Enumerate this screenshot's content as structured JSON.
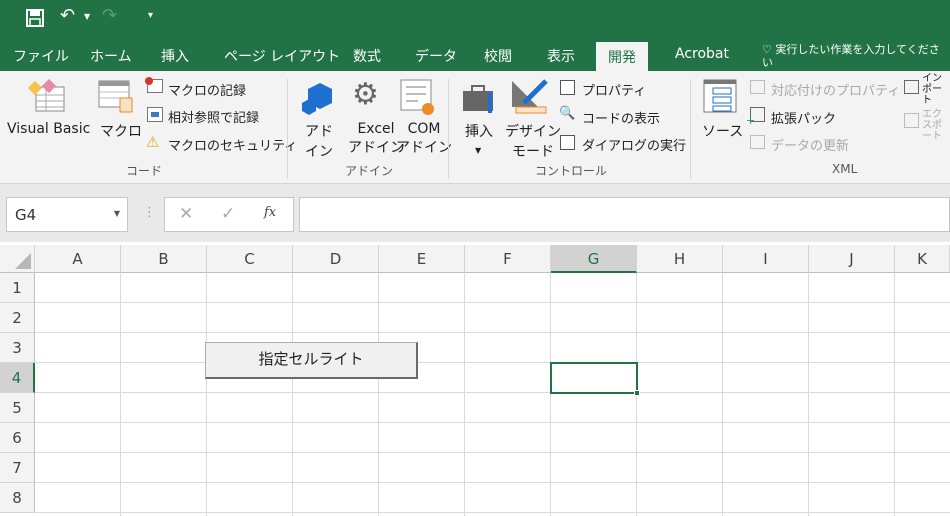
{
  "qat": {
    "save_icon": "save-icon",
    "undo_icon": "undo-icon",
    "redo_icon": "redo-icon",
    "customize_icon": "customize-qat-icon"
  },
  "tabs": [
    "ファイル",
    "ホーム",
    "挿入",
    "ページ レイアウト",
    "数式",
    "データ",
    "校閲",
    "表示",
    "開発",
    "Acrobat"
  ],
  "active_tab": "開発",
  "tell_me": "実行したい作業を入力してください",
  "ribbon": {
    "code": {
      "label": "コード",
      "visual_basic": "Visual Basic",
      "macro": "マクロ",
      "record": "マクロの記録",
      "relative": "相対参照で記録",
      "security": "マクロのセキュリティ"
    },
    "addins": {
      "label": "アドイン",
      "addin_1": "アド",
      "addin_2": "イン",
      "excel_1": "Excel",
      "excel_2": "アドイン",
      "com_1": "COM",
      "com_2": "アドイン"
    },
    "controls": {
      "label": "コントロール",
      "insert": "挿入",
      "design_1": "デザイン",
      "design_2": "モード",
      "properties": "プロパティ",
      "view_code": "コードの表示",
      "run_dialog": "ダイアログの実行"
    },
    "xml": {
      "label": "XML",
      "source": "ソース",
      "map_props": "対応付けのプロパティ",
      "expansion": "拡張パック",
      "refresh": "データの更新",
      "import": "インポート",
      "export": "エクスポート"
    }
  },
  "formula_bar": {
    "name_box": "G4",
    "formula": "",
    "fx": "fx"
  },
  "columns": [
    "A",
    "B",
    "C",
    "D",
    "E",
    "F",
    "G",
    "H",
    "I",
    "J",
    "K"
  ],
  "rows": [
    "1",
    "2",
    "3",
    "4",
    "5",
    "6",
    "7",
    "8"
  ],
  "selected_cell": "G4",
  "sheet_button": "指定セルライト",
  "colors": {
    "accent": "#217346"
  }
}
